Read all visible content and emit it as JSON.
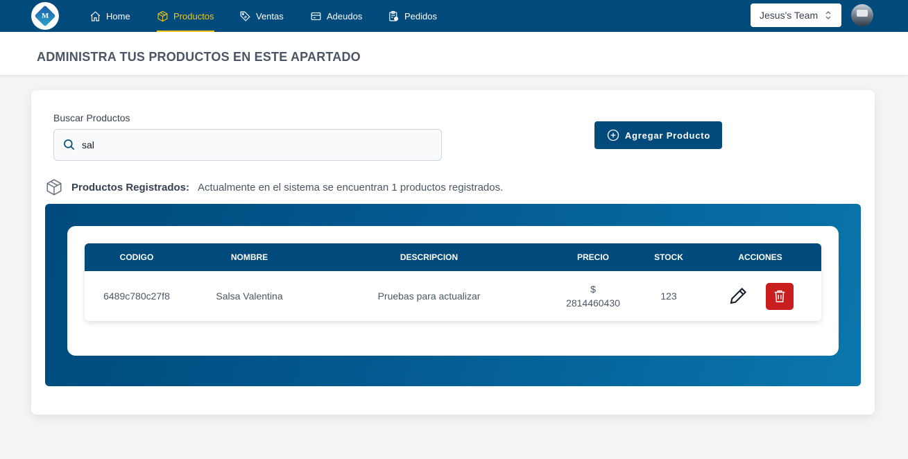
{
  "nav": {
    "logo_letter": "M",
    "items": [
      {
        "label": "Home",
        "icon": "home-icon",
        "active": false
      },
      {
        "label": "Productos",
        "icon": "box-icon",
        "active": true
      },
      {
        "label": "Ventas",
        "icon": "tag-icon",
        "active": false
      },
      {
        "label": "Adeudos",
        "icon": "wallet-icon",
        "active": false
      },
      {
        "label": "Pedidos",
        "icon": "clipboard-icon",
        "active": false
      }
    ],
    "team": "Jesus's Team"
  },
  "header": {
    "title": "ADMINISTRA TUS PRODUCTOS EN ESTE APARTADO"
  },
  "search": {
    "label": "Buscar Productos",
    "value": "sal"
  },
  "add_button": {
    "label": "Agregar Producto"
  },
  "registered": {
    "label": "Productos Registrados:",
    "text": "Actualmente en el sistema se encuentran 1 productos registrados."
  },
  "table": {
    "headers": [
      "CODIGO",
      "NOMBRE",
      "DESCRIPCION",
      "PRECIO",
      "STOCK",
      "ACCIONES"
    ],
    "rows": [
      {
        "codigo": "6489c780c27f8",
        "nombre": "Salsa Valentina",
        "descripcion": "Pruebas para actualizar",
        "precio_symbol": "$",
        "precio": "2814460430",
        "stock": "123"
      }
    ]
  },
  "colors": {
    "primary": "#004a7c",
    "active_nav": "#f5c518",
    "danger": "#c81e1e"
  }
}
